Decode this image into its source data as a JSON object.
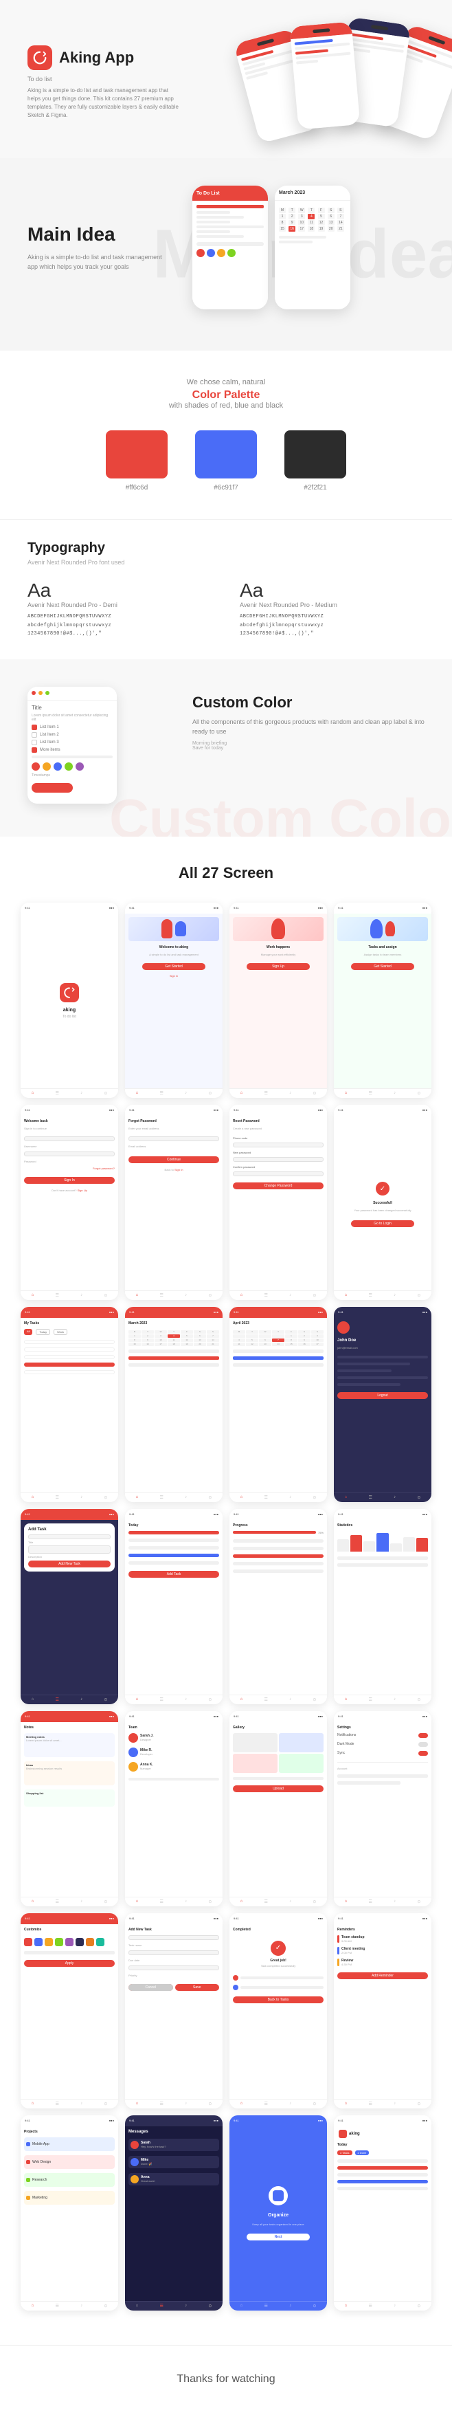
{
  "hero": {
    "logo_text": "Aking App",
    "tagline": "To do list",
    "description": "Aking is a simple to-do list and task management app that helps you get things done. This kit contains 27 premium app templates. They are fully customizable layers & easily editable Sketch & Figma."
  },
  "main_idea": {
    "bg_text": "Main Idea",
    "title": "Main Idea",
    "description": "Aking is a simple to-do list and task management app which helps you track your goals"
  },
  "color_palette": {
    "intro_sub": "We chose calm, natural",
    "intro_title": "Color Palette",
    "intro_suffix": "with shades of red, blue and black",
    "colors": [
      {
        "hex": "#e8453c",
        "label": "#ff6c6d"
      },
      {
        "hex": "#4a6cf7",
        "label": "#6c91f7"
      },
      {
        "hex": "#2c2c2c",
        "label": "#2f2f21"
      }
    ]
  },
  "typography": {
    "title": "Typography",
    "subtitle": "Avenir Next Rounded Pro font used",
    "fonts": [
      {
        "aa": "Aa",
        "name": "Avenir Next Rounded Pro - Demi",
        "alphabet": "ABCDEFGHIJKLMNOPQRSTUVWXYZ\nabcdefghijklmnopqrstuvwxyz\n1234567890!@#$...,()',\"",
        "weight": "demi"
      },
      {
        "aa": "Aa",
        "name": "Avenir Next Rounded Pro - Medium",
        "alphabet": "ABCDEFGHIJKLMNOPQRSTUVWXYZ\nabcdefghijklmnopqrstuvwxyz\n1234567890!@#$...,()',\"",
        "weight": "medium"
      }
    ]
  },
  "custom_color": {
    "bg_text": "Custom Color",
    "title": "Custom Color",
    "description": "All the components of this gorgeous products with random and clean app label & into ready to use",
    "timestamp1": "Morning briefing",
    "timestamp2": "Save for today"
  },
  "screens_section": {
    "title": "All 27 Screen",
    "thanks": "Thanks for watching"
  },
  "screens": {
    "onboarding": [
      {
        "label": "Welcome",
        "type": "splash"
      },
      {
        "label": "Work happens",
        "type": "onboard1"
      },
      {
        "label": "Tasks and assign",
        "type": "onboard2"
      },
      {
        "label": "Get Started",
        "type": "onboard3"
      }
    ],
    "auth": [
      {
        "label": "Welcome back",
        "type": "login"
      },
      {
        "label": "Forgot Password",
        "type": "forgot"
      },
      {
        "label": "Reset Password",
        "type": "reset"
      },
      {
        "label": "Successful",
        "type": "success"
      }
    ]
  }
}
